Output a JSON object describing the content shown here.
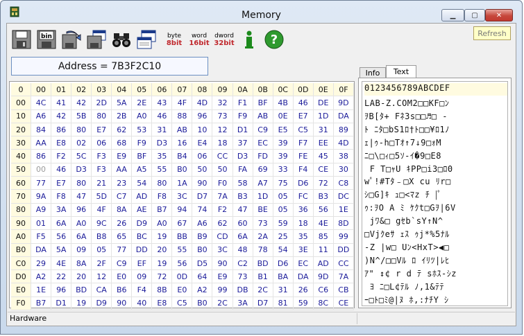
{
  "window": {
    "title": "Memory"
  },
  "toolbar": {
    "buttons": [
      {
        "name": "save-button",
        "icon": "floppy-icon"
      },
      {
        "name": "save-binary-button",
        "icon": "floppy-bin-icon",
        "label": "bin"
      },
      {
        "name": "load-button",
        "icon": "load-icon"
      },
      {
        "name": "edit-button",
        "icon": "edit-icon"
      },
      {
        "name": "find-button",
        "icon": "binoculars-icon"
      },
      {
        "name": "view-button",
        "icon": "window-icon"
      }
    ],
    "byte": {
      "top": "byte",
      "bottom": "8bit"
    },
    "word": {
      "top": "word",
      "bottom": "16bit"
    },
    "dword": {
      "top": "dword",
      "bottom": "32bit"
    },
    "refresh_label": "Refresh"
  },
  "address_label": "Address = 7B3F2C10",
  "hex": {
    "corner": "0",
    "columns": [
      "00",
      "01",
      "02",
      "03",
      "04",
      "05",
      "06",
      "07",
      "08",
      "09",
      "0A",
      "0B",
      "0C",
      "0D",
      "0E",
      "0F"
    ],
    "rows": [
      {
        "h": "00",
        "v": [
          "4C",
          "41",
          "42",
          "2D",
          "5A",
          "2E",
          "43",
          "4F",
          "4D",
          "32",
          "F1",
          "BF",
          "4B",
          "46",
          "DE",
          "9D"
        ]
      },
      {
        "h": "10",
        "v": [
          "A6",
          "42",
          "5B",
          "80",
          "2B",
          "A0",
          "46",
          "88",
          "96",
          "73",
          "F9",
          "AB",
          "0E",
          "E7",
          "1D",
          "DA"
        ]
      },
      {
        "h": "20",
        "v": [
          "84",
          "86",
          "80",
          "E7",
          "62",
          "53",
          "31",
          "AB",
          "10",
          "12",
          "D1",
          "C9",
          "E5",
          "C5",
          "31",
          "89"
        ]
      },
      {
        "h": "30",
        "v": [
          "AA",
          "E8",
          "02",
          "06",
          "68",
          "F9",
          "D3",
          "16",
          "E4",
          "18",
          "37",
          "EC",
          "39",
          "F7",
          "EE",
          "4D"
        ]
      },
      {
        "h": "40",
        "v": [
          "86",
          "F2",
          "5C",
          "F3",
          "E9",
          "BF",
          "35",
          "B4",
          "06",
          "CC",
          "D3",
          "FD",
          "39",
          "FE",
          "45",
          "38"
        ]
      },
      {
        "h": "50",
        "v": [
          "00",
          "46",
          "D3",
          "F3",
          "AA",
          "A5",
          "55",
          "B0",
          "50",
          "50",
          "FA",
          "69",
          "33",
          "F4",
          "CE",
          "30"
        ]
      },
      {
        "h": "60",
        "v": [
          "77",
          "E7",
          "80",
          "21",
          "23",
          "54",
          "80",
          "1A",
          "90",
          "F0",
          "58",
          "A7",
          "75",
          "D6",
          "72",
          "C8"
        ]
      },
      {
        "h": "70",
        "v": [
          "9A",
          "F8",
          "47",
          "5D",
          "C7",
          "AD",
          "F8",
          "3C",
          "D7",
          "7A",
          "B3",
          "1D",
          "05",
          "FC",
          "B3",
          "DC"
        ]
      },
      {
        "h": "80",
        "v": [
          "A9",
          "3A",
          "96",
          "4F",
          "8A",
          "AE",
          "B7",
          "94",
          "74",
          "F2",
          "47",
          "BE",
          "05",
          "36",
          "56",
          "1E"
        ]
      },
      {
        "h": "90",
        "v": [
          "01",
          "6A",
          "A0",
          "9C",
          "26",
          "D9",
          "A0",
          "67",
          "A6",
          "62",
          "60",
          "73",
          "59",
          "18",
          "4E",
          "8D"
        ]
      },
      {
        "h": "A0",
        "v": [
          "F5",
          "56",
          "6A",
          "B8",
          "65",
          "BC",
          "19",
          "BB",
          "B9",
          "CD",
          "6A",
          "2A",
          "25",
          "35",
          "85",
          "99"
        ]
      },
      {
        "h": "B0",
        "v": [
          "DA",
          "5A",
          "09",
          "05",
          "77",
          "DD",
          "20",
          "55",
          "B0",
          "3C",
          "48",
          "78",
          "54",
          "3E",
          "11",
          "DD"
        ]
      },
      {
        "h": "C0",
        "v": [
          "29",
          "4E",
          "8A",
          "2F",
          "C9",
          "EF",
          "19",
          "56",
          "D5",
          "90",
          "C2",
          "BD",
          "D6",
          "EC",
          "AD",
          "CC"
        ]
      },
      {
        "h": "D0",
        "v": [
          "A2",
          "22",
          "20",
          "12",
          "E0",
          "09",
          "72",
          "0D",
          "64",
          "E9",
          "73",
          "B1",
          "BA",
          "DA",
          "9D",
          "7A"
        ]
      },
      {
        "h": "E0",
        "v": [
          "1E",
          "96",
          "BD",
          "CA",
          "B6",
          "F4",
          "8B",
          "E0",
          "A2",
          "99",
          "DB",
          "2C",
          "31",
          "26",
          "C6",
          "CB"
        ]
      },
      {
        "h": "F0",
        "v": [
          "B7",
          "D1",
          "19",
          "D9",
          "90",
          "40",
          "E8",
          "C5",
          "B0",
          "2C",
          "3A",
          "D7",
          "81",
          "59",
          "8C",
          "CE"
        ]
      }
    ]
  },
  "tabs": {
    "info": "Info",
    "text": "Text"
  },
  "text_header": "0123456789ABCDEF",
  "text_lines": [
    "LAB-Z.COM2□□KF□ﾝ",
    "ｦB[ﾀ+ Fﾈ3s□□♬□ -",
    "ﾄ ﾆﾀ□bS1ﾛ†ﾄ□□¥ﾛ1ﾉ",
    "ｪ|ｩ-h□Tｵ↑7↓9□ｫM",
    "ﾆ□\\□ｨ□5ｿ-ｲ�9□E8",
    " F T□ｬU ｷPP□i3□ﾛ0",
    "wﾟ!#Tﾀ﹣□X cu ﾘr□",
    "ｼ□G]ｷ ｭ□<ﾏz ﾁ |ﾟ   ",
    "ｩ:ｦO A ﾐ ｹｸt□Gｦ|6V",
    " jﾜ&□ gｾb`sY↑N^",
    "□Vjｸeｻ ｪｽ ｩj*%5ﾅﾙ",
    "-Z |w□ Uﾝ<HxT>◀□",
    ")N^/□□Vﾙ ﾛ ｲﾘﾂ|ﾚﾋ",
    "ｱ\" ↕¢ r d ﾃ sﾎｽ-ｼz",
    " ﾖ ﾆ□L¢ﾃﾙ ﾉ,1&ﾃﾃ",
    "ｰ□ﾄ□ﾐ@|ﾇ ﾎ,:ﾅﾁY ｼ"
  ],
  "status": {
    "left": "Hardware"
  },
  "colors": {
    "header_bg": "#fffbe0",
    "hex_text": "#1a1a99",
    "accent_red": "#d02020"
  }
}
